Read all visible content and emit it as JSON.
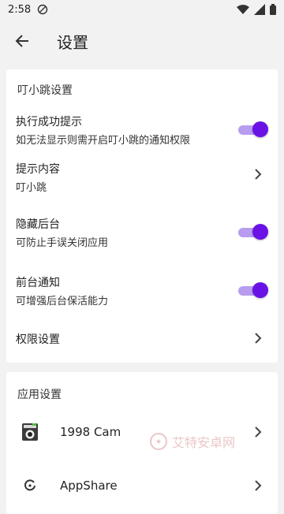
{
  "status_bar": {
    "time": "2:58"
  },
  "app_bar": {
    "title": "设置"
  },
  "section_dingxiaotiao": {
    "title": "叮小跳设置",
    "rows": [
      {
        "title": "执行成功提示",
        "subtitle": "如无法显示则需开启叮小跳的通知权限",
        "control": "switch",
        "on": true
      },
      {
        "title": "提示内容",
        "subtitle": "叮小跳",
        "control": "chevron"
      },
      {
        "title": "隐藏后台",
        "subtitle": "可防止手误关闭应用",
        "control": "switch",
        "on": true
      },
      {
        "title": "前台通知",
        "subtitle": "可增强后台保活能力",
        "control": "switch",
        "on": true
      },
      {
        "title": "权限设置",
        "control": "chevron"
      }
    ]
  },
  "section_apps": {
    "title": "应用设置",
    "apps": [
      {
        "name": "1998 Cam",
        "icon": "camera-app-icon"
      },
      {
        "name": "AppShare",
        "icon": "appshare-app-icon"
      }
    ]
  },
  "watermark": {
    "text": "艾特安卓网"
  },
  "colors": {
    "accent": "#6a12e6",
    "track": "#b89cf0",
    "background": "#f2f2f2",
    "card": "#ffffff"
  }
}
